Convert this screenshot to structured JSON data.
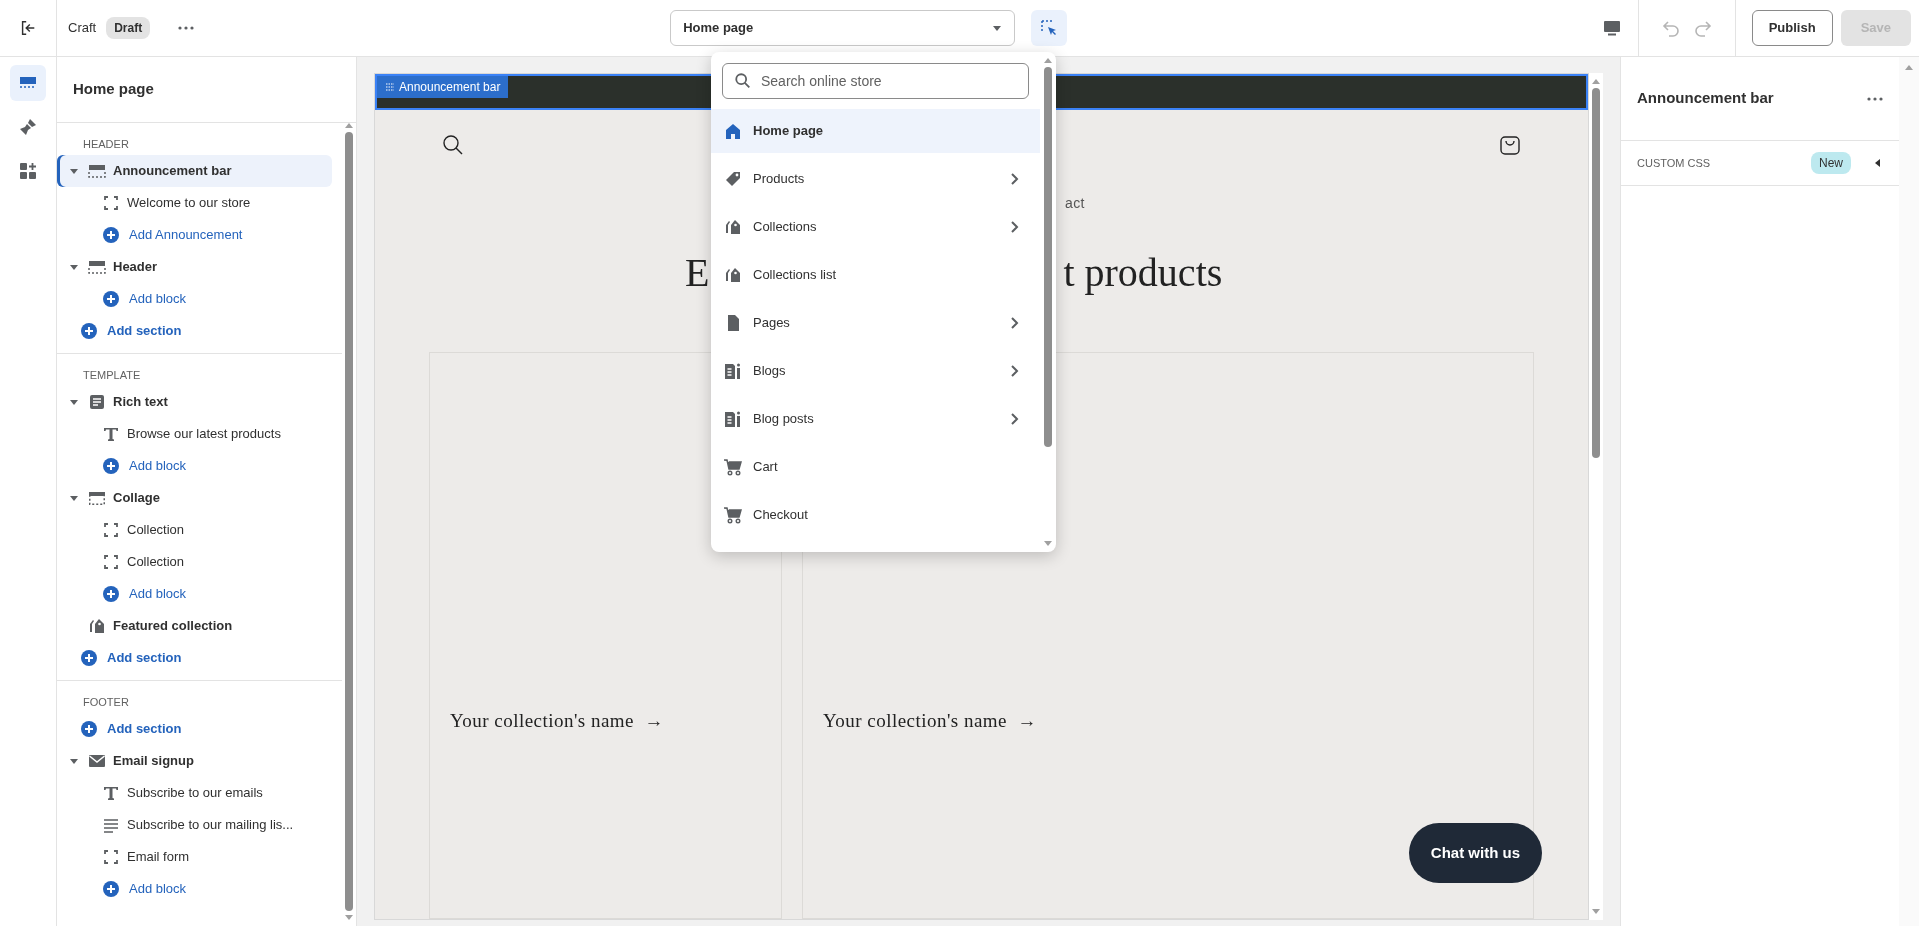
{
  "topbar": {
    "store": "Craft",
    "status": "Draft",
    "page_select": "Home page",
    "publish": "Publish",
    "save": "Save",
    "save_disabled": true
  },
  "rail": [
    {
      "kind": "sections",
      "selected": true
    },
    {
      "kind": "theme",
      "selected": false
    },
    {
      "kind": "apps",
      "selected": false
    }
  ],
  "sidebar": {
    "title": "Home page",
    "groups": [
      {
        "label": "HEADER",
        "items": [
          {
            "kind": "bar",
            "label": "Announcement bar",
            "expanded": true,
            "selected": true,
            "children": [
              {
                "kind": "block",
                "label": "Welcome to our store",
                "selected": false
              },
              {
                "kind": "add",
                "label": "Add Announcement"
              }
            ]
          },
          {
            "kind": "bar",
            "label": "Header",
            "expanded": true,
            "selected": false,
            "children": [
              {
                "kind": "add",
                "label": "Add block"
              }
            ]
          },
          {
            "kind": "add",
            "label": "Add section"
          }
        ]
      },
      {
        "label": "TEMPLATE",
        "items": [
          {
            "kind": "text",
            "label": "Rich text",
            "expanded": true,
            "selected": false,
            "children": [
              {
                "kind": "heading",
                "label": "Browse our latest products",
                "selected": false
              },
              {
                "kind": "add",
                "label": "Add block"
              }
            ]
          },
          {
            "kind": "collage",
            "label": "Collage",
            "expanded": true,
            "selected": false,
            "children": [
              {
                "kind": "block",
                "label": "Collection",
                "selected": false
              },
              {
                "kind": "block",
                "label": "Collection",
                "selected": false
              },
              {
                "kind": "add",
                "label": "Add block"
              }
            ]
          },
          {
            "kind": "collection",
            "label": "Featured collection",
            "selected": false
          },
          {
            "kind": "add",
            "label": "Add section"
          }
        ]
      },
      {
        "label": "FOOTER",
        "items": [
          {
            "kind": "add",
            "label": "Add section"
          },
          {
            "kind": "mail",
            "label": "Email signup",
            "expanded": true,
            "selected": false,
            "children": [
              {
                "kind": "heading",
                "label": "Subscribe to our emails",
                "selected": false
              },
              {
                "kind": "paragraph",
                "label": "Subscribe to our mailing lis...",
                "selected": false
              },
              {
                "kind": "block",
                "label": "Email form",
                "selected": false
              },
              {
                "kind": "add",
                "label": "Add block"
              }
            ]
          }
        ]
      }
    ]
  },
  "dropdown": {
    "placeholder": "Search online store",
    "items": [
      {
        "kind": "home",
        "label": "Home page",
        "selected": true,
        "submenu": false
      },
      {
        "kind": "tag",
        "label": "Products",
        "selected": false,
        "submenu": true
      },
      {
        "kind": "collection",
        "label": "Collections",
        "selected": false,
        "submenu": true
      },
      {
        "kind": "collection",
        "label": "Collections list",
        "selected": false,
        "submenu": false
      },
      {
        "kind": "page",
        "label": "Pages",
        "selected": false,
        "submenu": true
      },
      {
        "kind": "blog",
        "label": "Blogs",
        "selected": false,
        "submenu": true
      },
      {
        "kind": "blog",
        "label": "Blog posts",
        "selected": false,
        "submenu": true
      },
      {
        "kind": "cart",
        "label": "Cart",
        "selected": false,
        "submenu": false
      },
      {
        "kind": "cart",
        "label": "Checkout",
        "selected": false,
        "submenu": false
      }
    ]
  },
  "preview": {
    "section_label": "Announcement bar",
    "nav_fragment": "act",
    "heading_left": "E",
    "heading_right": "t products",
    "cards": [
      {
        "title": "Your collection's name",
        "arrow": "→"
      },
      {
        "title": "Your collection's name",
        "arrow": "→"
      }
    ],
    "chat": "Chat with us"
  },
  "settings": {
    "title": "Announcement bar",
    "rows": [
      {
        "label": "CUSTOM CSS",
        "badge": "New",
        "expanded": false
      }
    ]
  }
}
